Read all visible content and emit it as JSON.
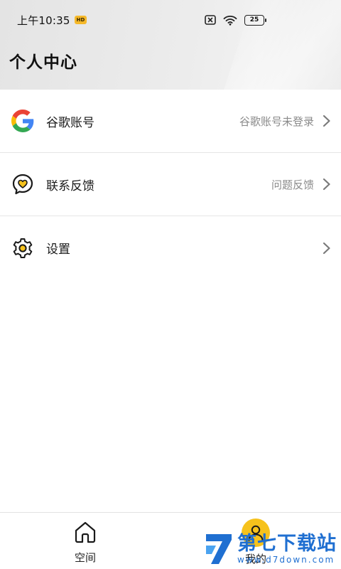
{
  "status_bar": {
    "time": "上午10:35",
    "badge": "HD",
    "battery": "25"
  },
  "header": {
    "title": "个人中心"
  },
  "menu": [
    {
      "label": "谷歌账号",
      "value": "谷歌账号未登录",
      "icon": "google-icon"
    },
    {
      "label": "联系反馈",
      "value": "问题反馈",
      "icon": "feedback-icon"
    },
    {
      "label": "设置",
      "value": "",
      "icon": "gear-icon"
    }
  ],
  "bottom_nav": {
    "tabs": [
      {
        "label": "空间",
        "icon": "home-icon"
      },
      {
        "label": "我的",
        "icon": "user-avatar-icon"
      }
    ]
  },
  "watermark": {
    "title": "第七下载站",
    "url": "www.d7down.com"
  },
  "colors": {
    "accent": "#f6c21c",
    "watermark": "#1f6fd1"
  }
}
